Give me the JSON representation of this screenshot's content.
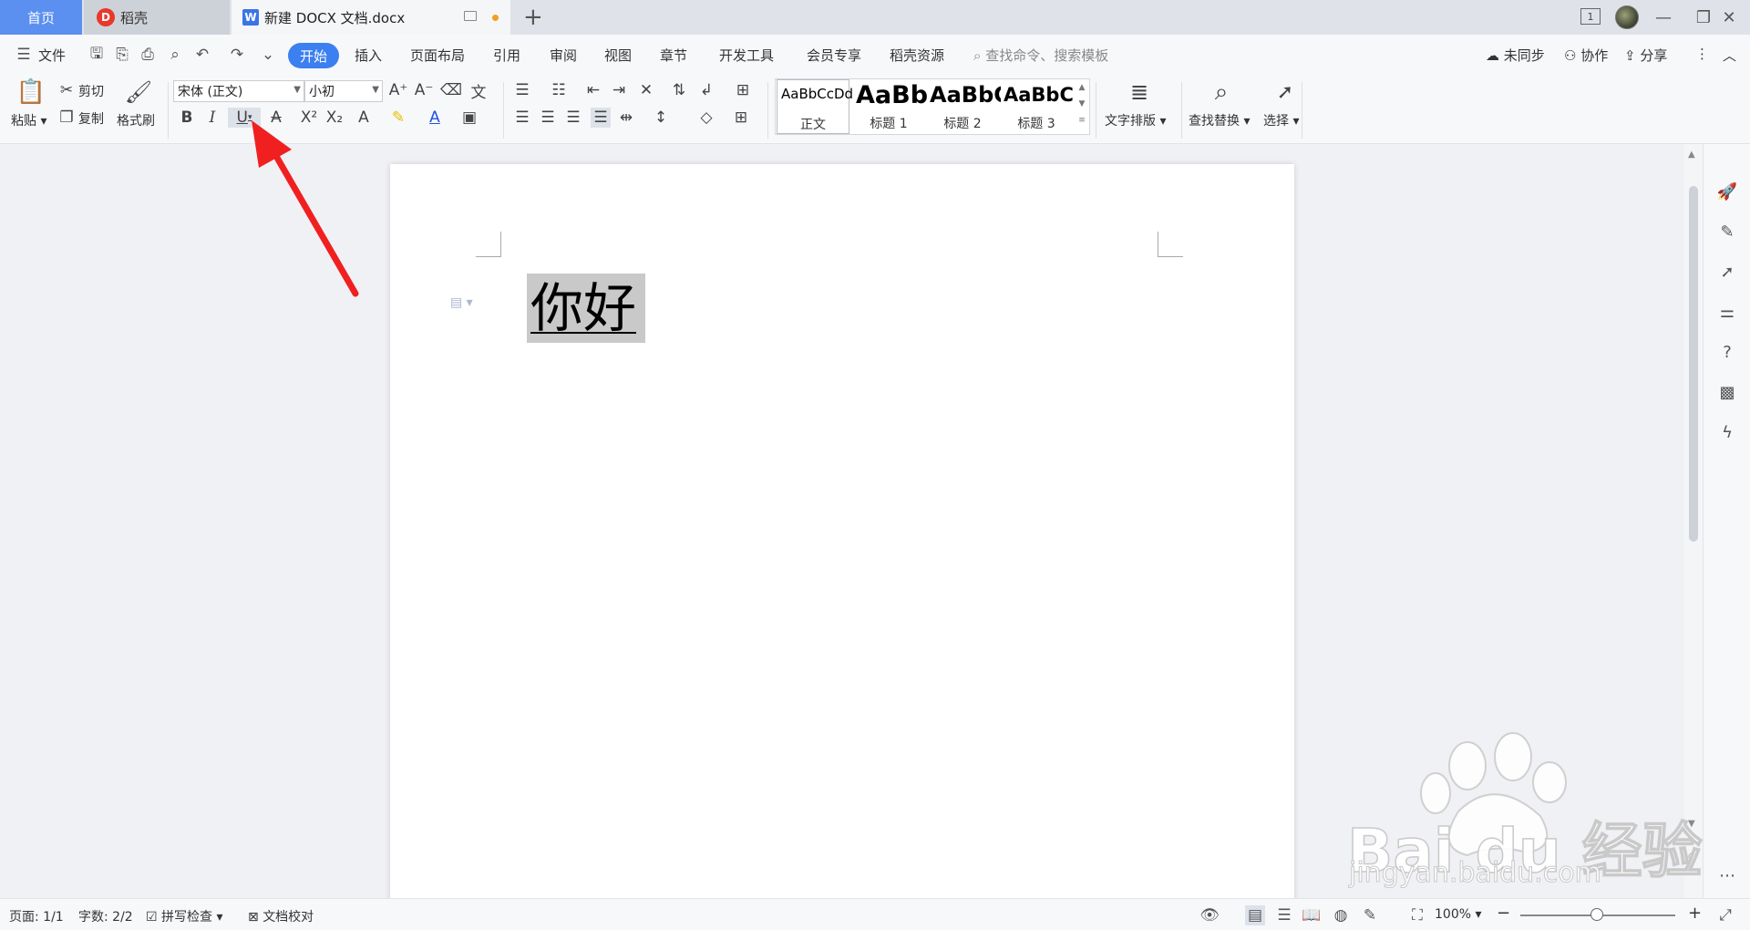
{
  "tabs": {
    "home": "首页",
    "daoke": "稻壳",
    "daoke_logo": "D",
    "doc_icon": "W",
    "doc": "新建 DOCX 文档.docx",
    "add": "+"
  },
  "window": {
    "badge": "1",
    "minimize": "—",
    "restore": "❐",
    "close": "✕"
  },
  "menu": {
    "file": "文件",
    "start": "开始",
    "items": [
      "插入",
      "页面布局",
      "引用",
      "审阅",
      "视图",
      "章节",
      "开发工具",
      "会员专享",
      "稻壳资源"
    ],
    "search": "查找命令、搜索模板",
    "sync": "未同步",
    "collab": "协作",
    "share": "分享",
    "more": "⋮",
    "collapse": "︿"
  },
  "ribbon": {
    "paste": "粘贴",
    "cut": "剪切",
    "copy": "复制",
    "format_painter": "格式刷",
    "font_name": "宋体 (正文)",
    "font_size": "小初",
    "bold": "B",
    "italic": "I",
    "underline": "U",
    "styles": {
      "normal_sample": "AaBbCcDd",
      "normal": "正文",
      "h1_sample": "AaBb",
      "h1": "标题 1",
      "h2_sample": "AaBbC",
      "h2": "标题 2",
      "h3_sample": "AaBbC",
      "h3": "标题 3"
    },
    "text_layout": "文字排版",
    "find_replace": "查找替换",
    "select": "选择"
  },
  "document": {
    "text": "你好"
  },
  "status": {
    "page": "页面: 1/1",
    "words": "字数: 2/2",
    "spell": "拼写检查",
    "proof": "文档校对",
    "zoom": "100%",
    "zoom_minus": "−",
    "zoom_plus": "+"
  },
  "watermark": {
    "brand": "Bai du 经验",
    "url": "jingyan.baidu.com"
  },
  "colors": {
    "accent": "#3b7ff0",
    "home_tab": "#5b8ff0",
    "selection": "#c9c9c9",
    "arrow": "#f02020"
  }
}
